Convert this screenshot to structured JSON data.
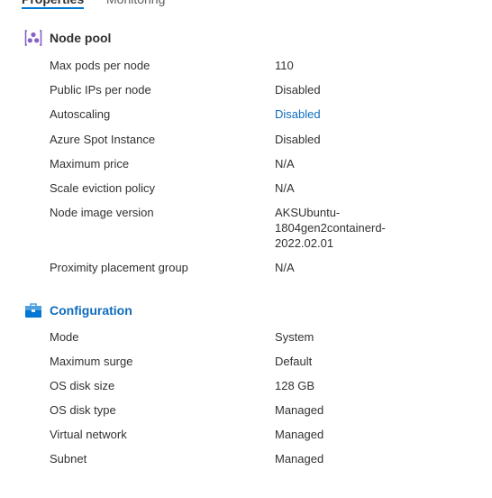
{
  "tabs": [
    {
      "label": "Properties",
      "active": true
    },
    {
      "label": "Monitoring",
      "active": false
    }
  ],
  "node_pool": {
    "title": "Node pool",
    "icon": "node-pool-icon",
    "rows": [
      {
        "label": "Max pods per node",
        "value": "110"
      },
      {
        "label": "Public IPs per node",
        "value": "Disabled"
      },
      {
        "label": "Autoscaling",
        "value": "Disabled",
        "link": true
      },
      {
        "label": "Azure Spot Instance",
        "value": "Disabled"
      },
      {
        "label": "Maximum price",
        "value": "N/A"
      },
      {
        "label": "Scale eviction policy",
        "value": "N/A"
      },
      {
        "label": "Node image version",
        "value_lines": [
          "AKSUbuntu-",
          "1804gen2containerd-",
          "2022.02.01"
        ]
      },
      {
        "label": "Proximity placement group",
        "value": "N/A"
      }
    ]
  },
  "configuration": {
    "title": "Configuration",
    "icon": "toolbox-icon",
    "rows": [
      {
        "label": "Mode",
        "value": "System"
      },
      {
        "label": "Maximum surge",
        "value": "Default"
      },
      {
        "label": "OS disk size",
        "value": "128 GB"
      },
      {
        "label": "OS disk type",
        "value": "Managed"
      },
      {
        "label": "Virtual network",
        "value": "Managed"
      },
      {
        "label": "Subnet",
        "value": "Managed"
      }
    ]
  },
  "colors": {
    "accent": "#0078d4",
    "link": "#0f6cbd",
    "text": "#323130",
    "node_pool_icon": "#8661c5",
    "config_icon": "#0078d4"
  }
}
